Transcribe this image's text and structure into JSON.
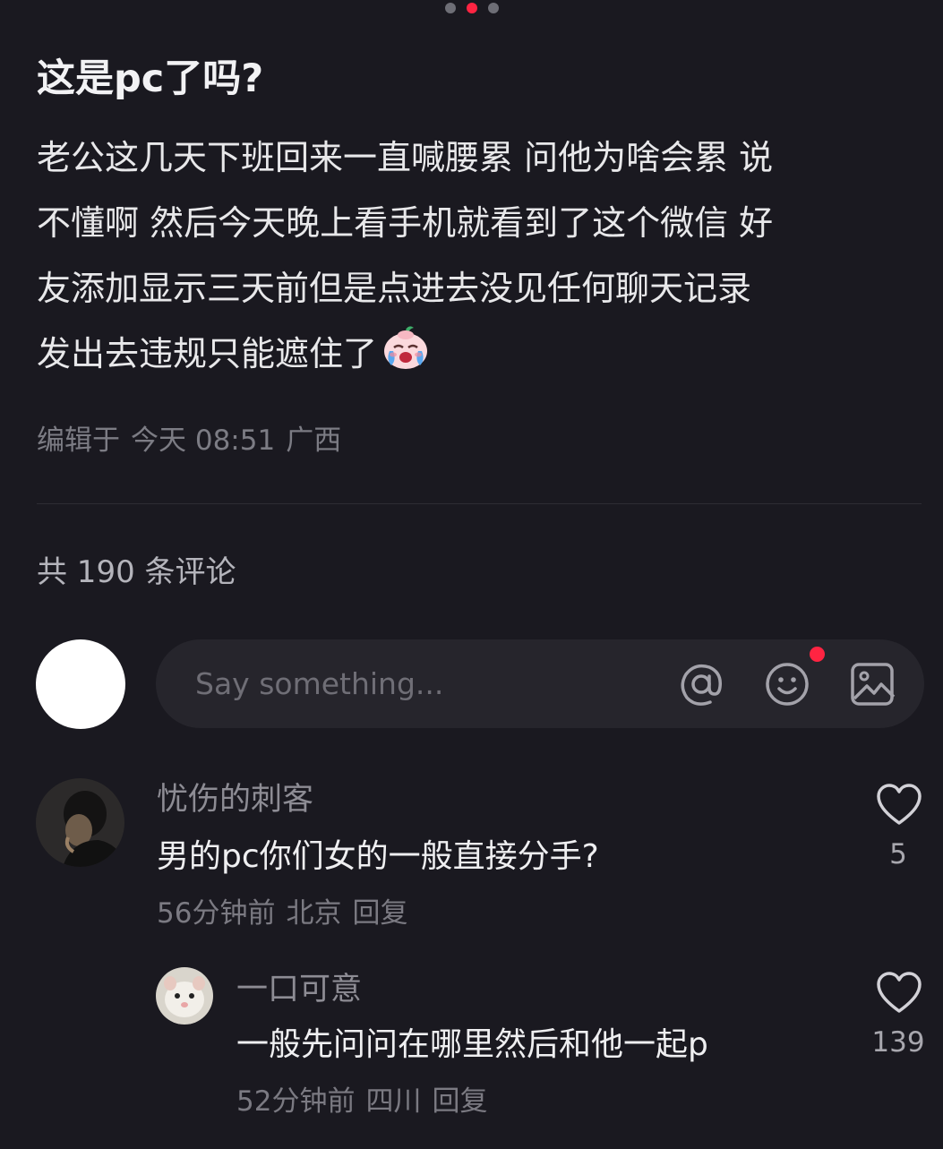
{
  "carousel": {
    "count": 3,
    "active_index": 1
  },
  "post": {
    "title": "这是pc了吗?",
    "body_lines": [
      "老公这几天下班回来一直喊腰累 问他为啥会累 说",
      "不懂啊 然后今天晚上看手机就看到了这个微信 好",
      "友添加显示三天前但是点进去没见任何聊天记录",
      "发出去违规只能遮住了"
    ],
    "body_emoji": "crying-face-emoji",
    "edited_label": "编辑于",
    "edited_time": "今天 08:51",
    "location": "广西"
  },
  "comments_section": {
    "count_label": "共 190 条评论",
    "input_placeholder": "Say something...",
    "icons": [
      "at-icon",
      "emoji-icon",
      "image-icon"
    ],
    "accent_color": "#ff2442"
  },
  "comments": [
    {
      "username": "忧伤的刺客",
      "text": "男的pc你们女的一般直接分手?",
      "time": "56分钟前",
      "location": "北京",
      "reply_label": "回复",
      "likes": "5"
    },
    {
      "username": "一口可意",
      "text": "一般先问问在哪里然后和他一起p",
      "time": "52分钟前",
      "location": "四川",
      "reply_label": "回复",
      "likes": "139"
    }
  ]
}
